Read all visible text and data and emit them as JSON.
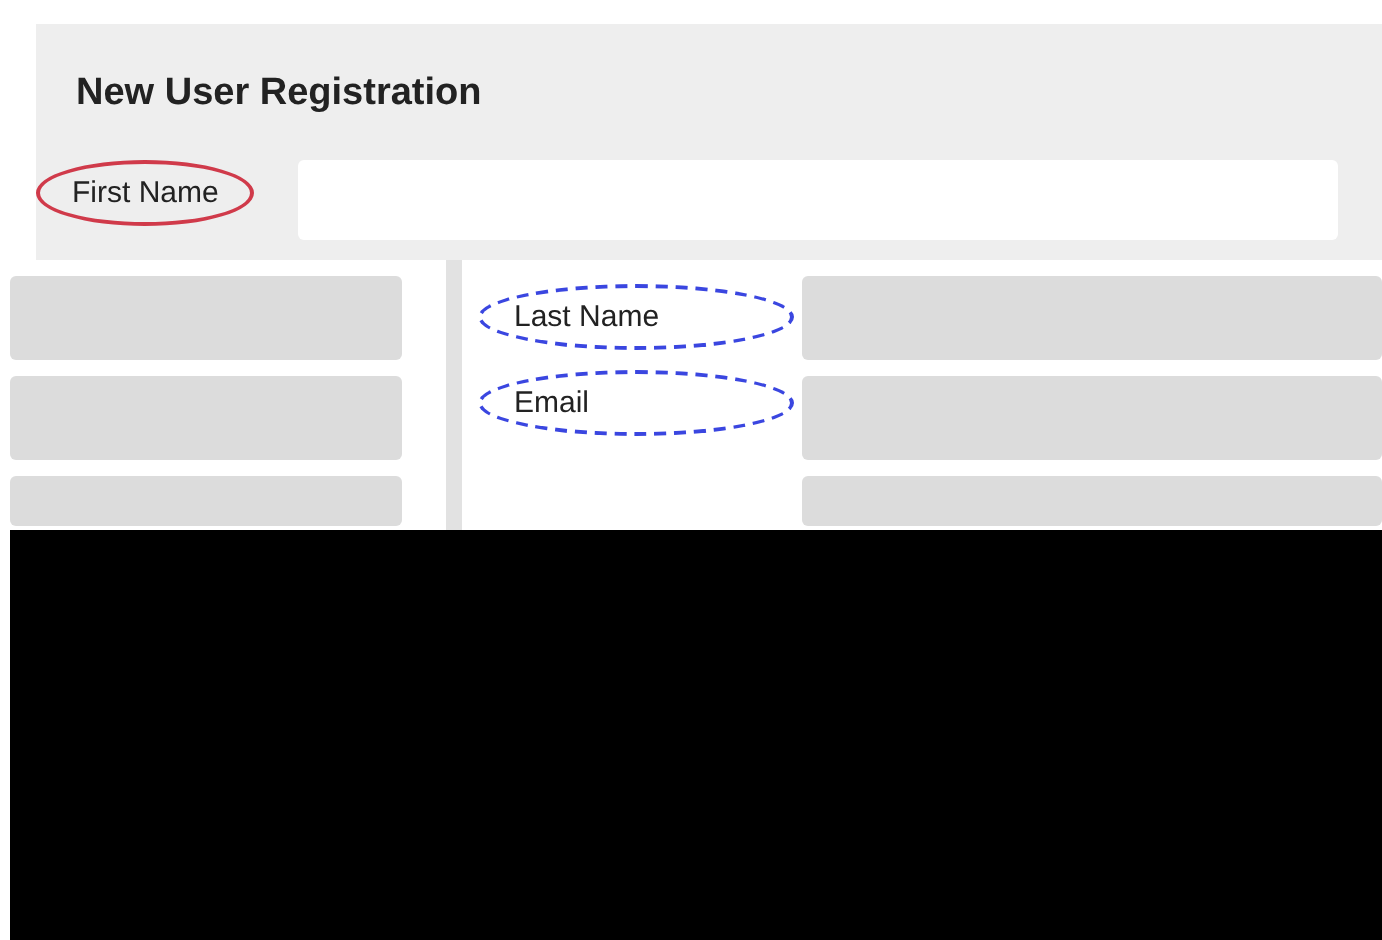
{
  "form": {
    "title": "New User Registration",
    "first_field": {
      "label": "First Name",
      "color": "#d03a4a",
      "kind": "solid"
    },
    "fields": [
      {
        "label": "Last Name",
        "color": "#3a46e0",
        "kind": "dashed"
      },
      {
        "label": "Email",
        "color": "#3a46e0",
        "kind": "dashed"
      }
    ]
  }
}
